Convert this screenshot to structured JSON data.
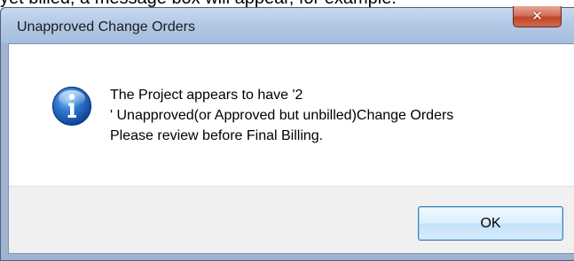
{
  "background": {
    "text": "yet billed, a message box will appear, for example:"
  },
  "dialog": {
    "title": "Unapproved Change Orders",
    "close_icon": "close-icon",
    "icon": "information-icon",
    "message_lines": [
      "The Project appears to have '2",
      "' Unapproved(or Approved but unbilled)Change Orders",
      "Please review before Final Billing."
    ],
    "ok_label": "OK"
  },
  "colors": {
    "frame": "#9fb4d0",
    "titlebar": "#b4c8e6",
    "close_button": "#c04528",
    "info_icon": "#1d5fb5",
    "ok_border": "#3c7fb1",
    "button_area": "#f0f0f0"
  }
}
